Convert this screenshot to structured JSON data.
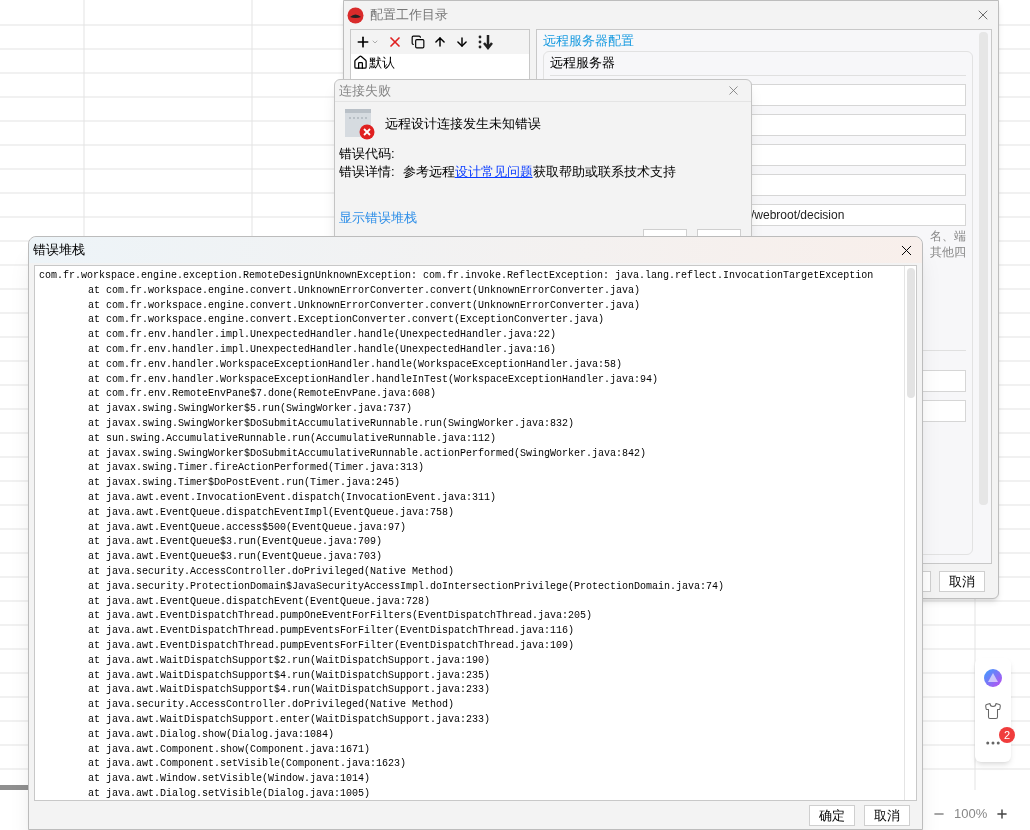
{
  "config_window": {
    "title": "配置工作目录",
    "tree": [
      {
        "label": "默认",
        "selected": false
      }
    ],
    "section_title": "远程服务器配置",
    "server_label": "远程服务器",
    "url_field": {
      "value": "/webroot/decision"
    },
    "hint": [
      "名、端",
      "其他四"
    ],
    "buttons": [
      "取消"
    ]
  },
  "connection_dialog": {
    "title": "连接失败",
    "message": "远程设计连接发生未知错误",
    "error_code_label": "错误代码:",
    "details_label": "错误详情:",
    "details_prefix": "参考远程",
    "details_link": "设计常见问题",
    "details_suffix": "获取帮助或联系技术支持",
    "show_stack_link": "显示错误堆栈"
  },
  "stack_window": {
    "title": "错误堆栈",
    "lines": [
      {
        "kind": "exception",
        "text": "com.fr.workspace.engine.exception.RemoteDesignUnknownException: com.fr.invoke.ReflectException: java.lang.reflect.InvocationTargetException"
      },
      {
        "kind": "frame",
        "text": "at com.fr.workspace.engine.convert.UnknownErrorConverter.convert(UnknownErrorConverter.java)"
      },
      {
        "kind": "frame",
        "text": "at com.fr.workspace.engine.convert.UnknownErrorConverter.convert(UnknownErrorConverter.java)"
      },
      {
        "kind": "frame",
        "text": "at com.fr.workspace.engine.convert.ExceptionConverter.convert(ExceptionConverter.java)"
      },
      {
        "kind": "frame",
        "text": "at com.fr.env.handler.impl.UnexpectedHandler.handle(UnexpectedHandler.java:22)"
      },
      {
        "kind": "frame",
        "text": "at com.fr.env.handler.impl.UnexpectedHandler.handle(UnexpectedHandler.java:16)"
      },
      {
        "kind": "frame",
        "text": "at com.fr.env.handler.WorkspaceExceptionHandler.handle(WorkspaceExceptionHandler.java:58)"
      },
      {
        "kind": "frame",
        "text": "at com.fr.env.handler.WorkspaceExceptionHandler.handleInTest(WorkspaceExceptionHandler.java:94)"
      },
      {
        "kind": "frame",
        "text": "at com.fr.env.RemoteEnvPane$7.done(RemoteEnvPane.java:608)"
      },
      {
        "kind": "frame",
        "text": "at javax.swing.SwingWorker$5.run(SwingWorker.java:737)"
      },
      {
        "kind": "frame",
        "text": "at javax.swing.SwingWorker$DoSubmitAccumulativeRunnable.run(SwingWorker.java:832)"
      },
      {
        "kind": "frame",
        "text": "at sun.swing.AccumulativeRunnable.run(AccumulativeRunnable.java:112)"
      },
      {
        "kind": "frame",
        "text": "at javax.swing.SwingWorker$DoSubmitAccumulativeRunnable.actionPerformed(SwingWorker.java:842)"
      },
      {
        "kind": "frame",
        "text": "at javax.swing.Timer.fireActionPerformed(Timer.java:313)"
      },
      {
        "kind": "frame",
        "text": "at javax.swing.Timer$DoPostEvent.run(Timer.java:245)"
      },
      {
        "kind": "frame",
        "text": "at java.awt.event.InvocationEvent.dispatch(InvocationEvent.java:311)"
      },
      {
        "kind": "frame",
        "text": "at java.awt.EventQueue.dispatchEventImpl(EventQueue.java:758)"
      },
      {
        "kind": "frame",
        "text": "at java.awt.EventQueue.access$500(EventQueue.java:97)"
      },
      {
        "kind": "frame",
        "text": "at java.awt.EventQueue$3.run(EventQueue.java:709)"
      },
      {
        "kind": "frame",
        "text": "at java.awt.EventQueue$3.run(EventQueue.java:703)"
      },
      {
        "kind": "frame",
        "text": "at java.security.AccessController.doPrivileged(Native Method)"
      },
      {
        "kind": "frame",
        "text": "at java.security.ProtectionDomain$JavaSecurityAccessImpl.doIntersectionPrivilege(ProtectionDomain.java:74)"
      },
      {
        "kind": "frame",
        "text": "at java.awt.EventQueue.dispatchEvent(EventQueue.java:728)"
      },
      {
        "kind": "frame",
        "text": "at java.awt.EventDispatchThread.pumpOneEventForFilters(EventDispatchThread.java:205)"
      },
      {
        "kind": "frame",
        "text": "at java.awt.EventDispatchThread.pumpEventsForFilter(EventDispatchThread.java:116)"
      },
      {
        "kind": "frame",
        "text": "at java.awt.EventDispatchThread.pumpEventsForFilter(EventDispatchThread.java:109)"
      },
      {
        "kind": "frame",
        "text": "at java.awt.WaitDispatchSupport$2.run(WaitDispatchSupport.java:190)"
      },
      {
        "kind": "frame",
        "text": "at java.awt.WaitDispatchSupport$4.run(WaitDispatchSupport.java:235)"
      },
      {
        "kind": "frame",
        "text": "at java.awt.WaitDispatchSupport$4.run(WaitDispatchSupport.java:233)"
      },
      {
        "kind": "frame",
        "text": "at java.security.AccessController.doPrivileged(Native Method)"
      },
      {
        "kind": "frame",
        "text": "at java.awt.WaitDispatchSupport.enter(WaitDispatchSupport.java:233)"
      },
      {
        "kind": "frame",
        "text": "at java.awt.Dialog.show(Dialog.java:1084)"
      },
      {
        "kind": "frame",
        "text": "at java.awt.Component.show(Component.java:1671)"
      },
      {
        "kind": "frame",
        "text": "at java.awt.Component.setVisible(Component.java:1623)"
      },
      {
        "kind": "frame",
        "text": "at java.awt.Window.setVisible(Window.java:1014)"
      },
      {
        "kind": "frame",
        "text": "at java.awt.Dialog.setVisible(Dialog.java:1005)"
      }
    ],
    "buttons": [
      "确定",
      "取消"
    ]
  },
  "side_panel": {
    "badge": "2"
  },
  "zoom": {
    "value": "100%"
  }
}
